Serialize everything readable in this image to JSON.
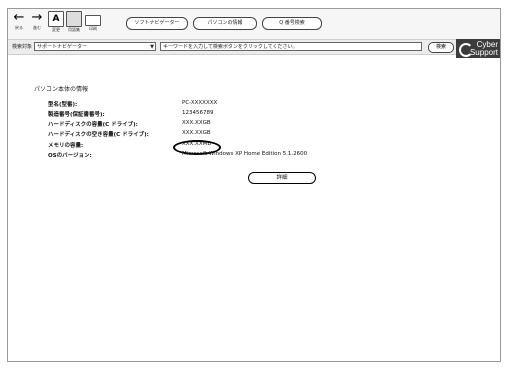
{
  "toolbar": {
    "buttons": [
      {
        "label": "戻る"
      },
      {
        "label": "進む"
      },
      {
        "label": "変更"
      },
      {
        "label": "用語集"
      },
      {
        "label": "印刷"
      }
    ],
    "pills": [
      "ソフトナビゲーター",
      "パソコンの情報",
      "Q 番号検索"
    ]
  },
  "search": {
    "label": "検索対象",
    "scope_value": "サポートナビゲーター",
    "input_placeholder": "キーワードを入力して検索ボタンをクリックしてください。",
    "button_label": "検索"
  },
  "logo": {
    "line1": "Cyber",
    "line2": "Support"
  },
  "info": {
    "title": "パソコン本体の情報",
    "rows": [
      {
        "label": "型名(型番):",
        "value": "PC-XXXXXXX"
      },
      {
        "label": "製造番号(保証書番号):",
        "value": "123456789"
      },
      {
        "label": "ハードディスクの容量(C ドライブ):",
        "value": "XXX.XXGB"
      },
      {
        "label": "ハードディスクの空き容量(C ドライブ):",
        "value": "XXX.XXGB"
      },
      {
        "label": "メモリの容量:",
        "value": "XXX.XXMB"
      },
      {
        "label": "OSのバージョン:",
        "value": "Microsoft Windows XP Home Edition 5.1.2600"
      }
    ],
    "detail_button": "詳細"
  }
}
